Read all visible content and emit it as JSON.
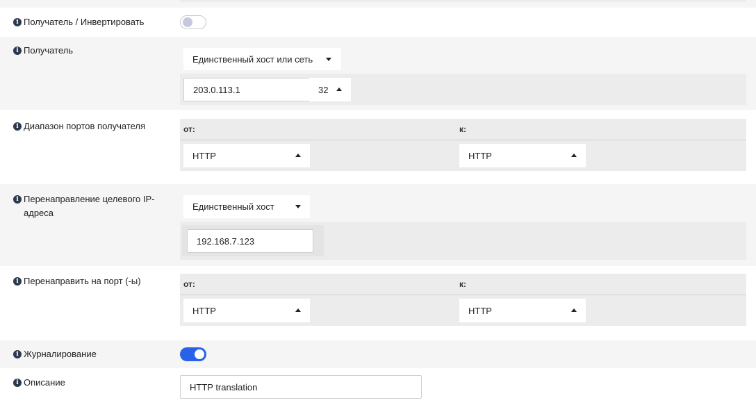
{
  "rows": {
    "dest_invert": {
      "label": "Получатель / Инвертировать",
      "enabled": false
    },
    "destination": {
      "label": "Получатель",
      "type_select": "Единственный хост или сеть",
      "address": "203.0.113.1",
      "mask": "32"
    },
    "dest_port_range": {
      "label": "Диапазон портов получателя",
      "from_label": "от:",
      "to_label": "к:",
      "from_value": "HTTP",
      "to_value": "HTTP"
    },
    "redirect_target_ip": {
      "label_line1": "Перенаправление целевого IP-",
      "label_line2": "адреса",
      "type_select": "Единственный хост",
      "address": "192.168.7.123"
    },
    "redirect_port": {
      "label": "Перенаправить на порт (-ы)",
      "from_label": "от:",
      "to_label": "к:",
      "from_value": "HTTP",
      "to_value": "HTTP"
    },
    "logging": {
      "label": "Журналирование",
      "enabled": true
    },
    "description": {
      "label": "Описание",
      "value": "HTTP translation"
    }
  },
  "colors": {
    "accent": "#2862e9",
    "row_alt": "#f5f5f5",
    "panel": "#ececec"
  }
}
